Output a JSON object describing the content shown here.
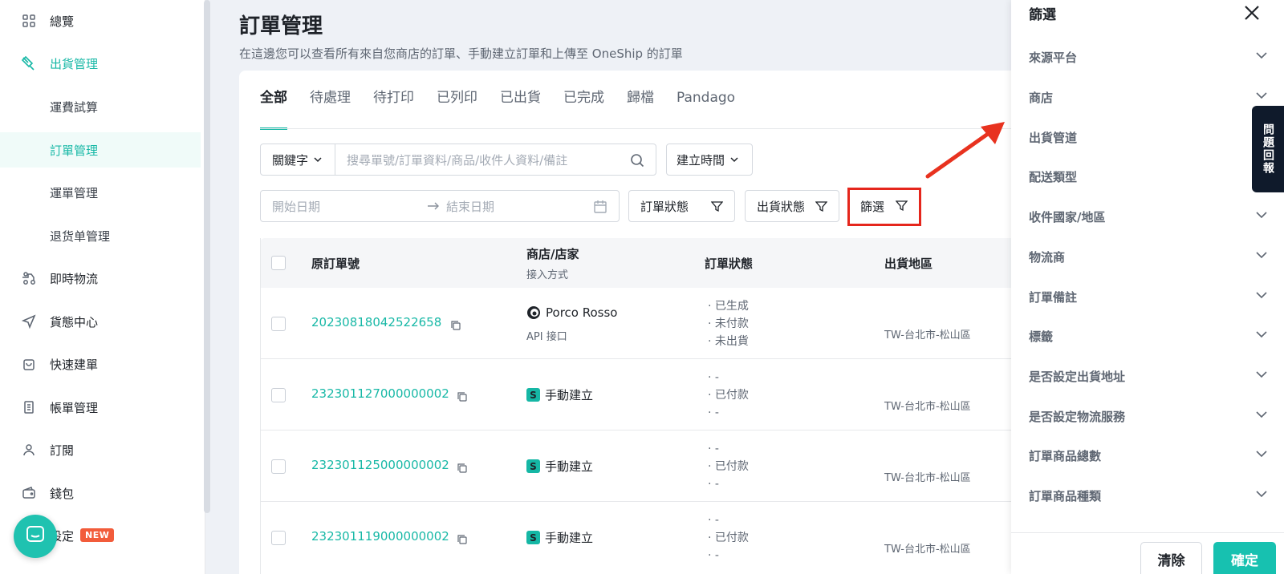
{
  "sidebar": {
    "items": [
      {
        "label": "總覽",
        "icon": "grid-icon"
      },
      {
        "label": "出貨管理",
        "icon": "truck-icon"
      },
      {
        "label": "運費試算"
      },
      {
        "label": "訂單管理"
      },
      {
        "label": "運單管理"
      },
      {
        "label": "退货单管理"
      },
      {
        "label": "即時物流",
        "icon": "delivery-icon"
      },
      {
        "label": "貨態中心",
        "icon": "send-icon"
      },
      {
        "label": "快速建單",
        "icon": "bag-icon"
      },
      {
        "label": "帳單管理",
        "icon": "bill-icon"
      },
      {
        "label": "訂閱",
        "icon": "user-icon"
      },
      {
        "label": "錢包",
        "icon": "wallet-icon"
      },
      {
        "label": "設定",
        "badge": "NEW"
      }
    ]
  },
  "header": {
    "title": "訂單管理",
    "subtitle": "在這邊您可以查看所有來自您商店的訂單、手動建立訂單和上傳至 OneShip 的訂單"
  },
  "tabs": [
    "全部",
    "待處理",
    "待打印",
    "已列印",
    "已出貨",
    "已完成",
    "歸檔",
    "Pandago"
  ],
  "filters": {
    "keyword_label": "關鍵字",
    "search_placeholder": "搜尋單號/訂單資料/商品/收件人資料/備註",
    "created_time_label": "建立時間",
    "start_date_placeholder": "開始日期",
    "end_date_placeholder": "結束日期",
    "order_status_label": "訂單狀態",
    "shipping_status_label": "出貨狀態",
    "filter_label": "篩選"
  },
  "table": {
    "headers": {
      "order_no": "原訂單號",
      "store": "商店/店家",
      "store_sub": "接入方式",
      "order_status": "訂單狀態",
      "region": "出貨地區"
    },
    "rows": [
      {
        "order_no": "20230818042522658",
        "store": "Porco Rosso",
        "store_sub": "API 接口",
        "status": [
          "· 已生成",
          "· 未付款",
          "· 未出貨"
        ],
        "region": "TW-台北市-松山區"
      },
      {
        "order_no": "232301127000000002",
        "store_tag": "S",
        "store": "手動建立",
        "status": [
          "· -",
          "· 已付款",
          "· -"
        ],
        "region": "TW-台北市-松山區"
      },
      {
        "order_no": "232301125000000002",
        "store_tag": "S",
        "store": "手動建立",
        "status": [
          "· -",
          "· 已付款",
          "· -"
        ],
        "region": "TW-台北市-松山區"
      },
      {
        "order_no": "232301119000000002",
        "store_tag": "S",
        "store": "手動建立",
        "status": [
          "· -",
          "· 已付款",
          "· -"
        ],
        "region": "TW-台北市-松山區"
      }
    ]
  },
  "drawer": {
    "title": "篩選",
    "items": [
      "來源平台",
      "商店",
      "出貨管道",
      "配送類型",
      "收件國家/地區",
      "物流商",
      "訂單備註",
      "標籤",
      "是否設定出貨地址",
      "是否設定物流服務",
      "訂單商品總數",
      "訂單商品種類"
    ],
    "clear_label": "清除",
    "confirm_label": "確定"
  },
  "feedback_label": "問題回報",
  "colors": {
    "accent": "#17b8a6",
    "highlight": "#e5261c",
    "new_badge": "#f25c3b"
  }
}
